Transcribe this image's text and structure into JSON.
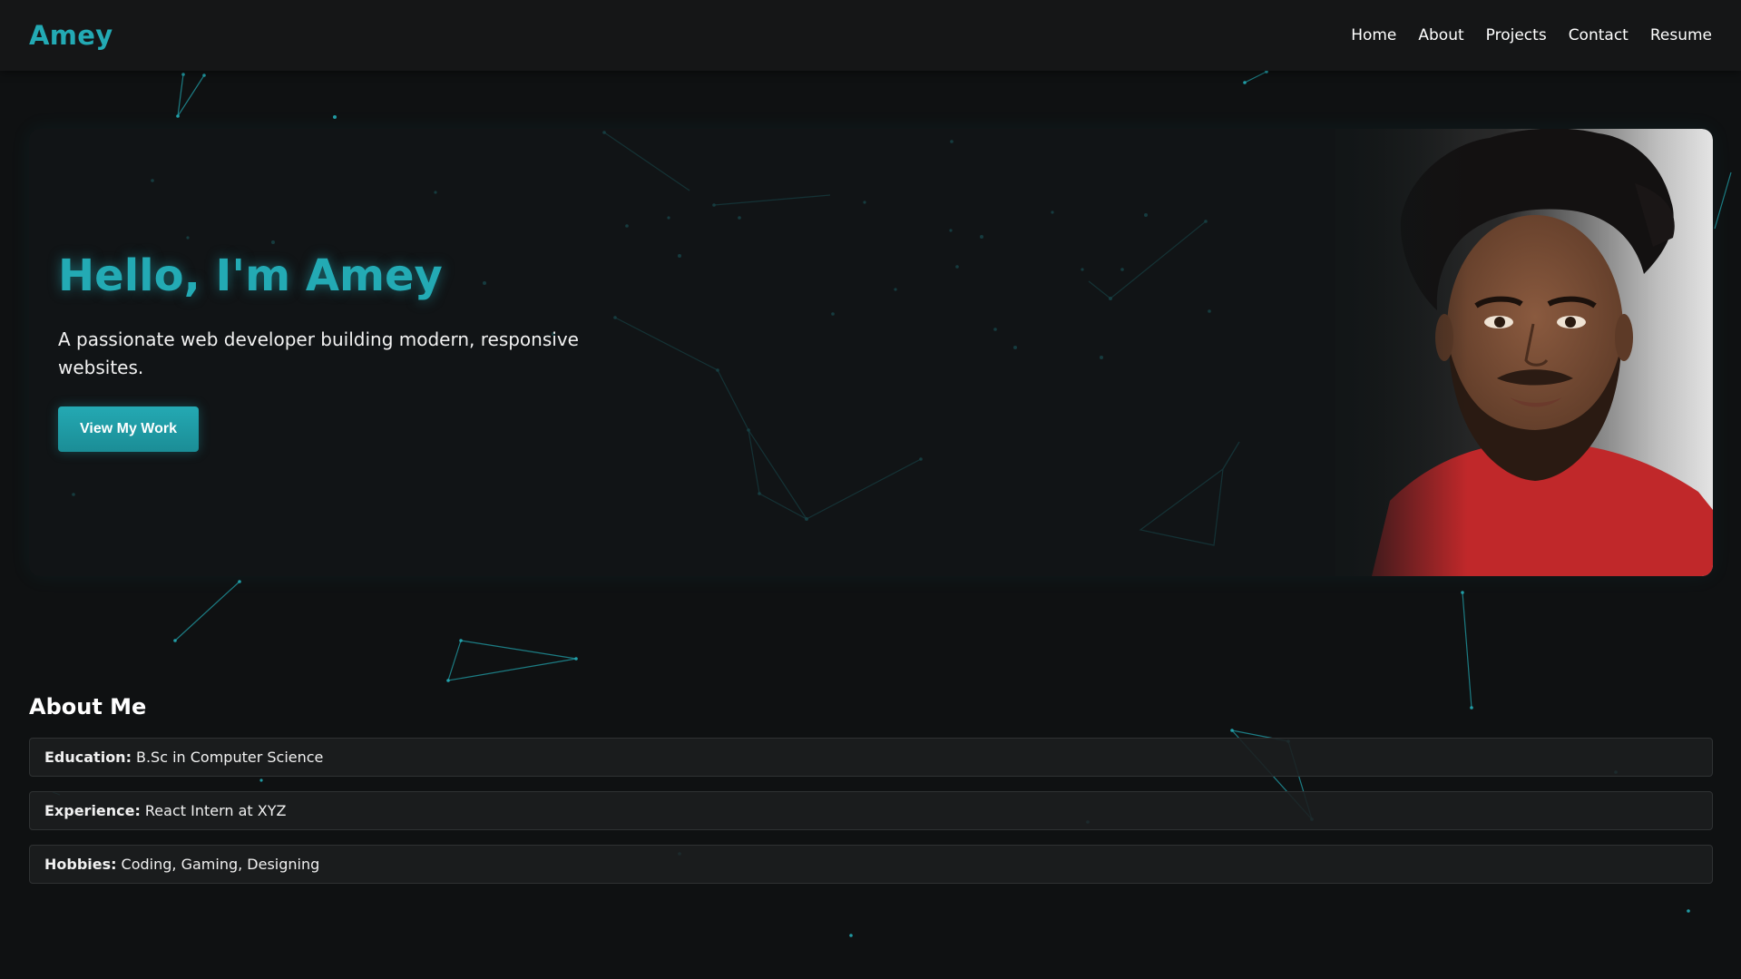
{
  "navbar": {
    "logo": "Amey",
    "links": [
      "Home",
      "About",
      "Projects",
      "Contact",
      "Resume"
    ]
  },
  "hero": {
    "title": "Hello, I'm Amey",
    "subtitle": "A passionate web developer building modern, responsive websites.",
    "cta_label": "View My Work"
  },
  "about": {
    "title": "About Me",
    "items": [
      {
        "key": "Education:",
        "value": "B.Sc in Computer Science"
      },
      {
        "key": "Experience:",
        "value": "React Intern at XYZ"
      },
      {
        "key": "Hobbies:",
        "value": "Coding, Gaming, Designing"
      }
    ]
  },
  "colors": {
    "accent": "#23aab4",
    "background": "#0f1112",
    "navbar": "#151617",
    "card": "#1c1e1f",
    "portrait_shirt": "#c0282a"
  }
}
